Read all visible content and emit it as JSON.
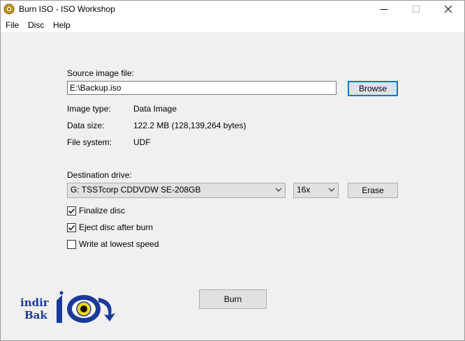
{
  "window": {
    "title": "Burn ISO - ISO Workshop"
  },
  "menu": [
    "File",
    "Disc",
    "Help"
  ],
  "source": {
    "label": "Source image file:",
    "value": "E:\\Backup.iso",
    "browse_label": "Browse"
  },
  "info": {
    "image_type_label": "Image type:",
    "image_type_value": "Data Image",
    "data_size_label": "Data size:",
    "data_size_value": "122.2 MB (128,139,264 bytes)",
    "file_system_label": "File system:",
    "file_system_value": "UDF"
  },
  "destination": {
    "label": "Destination drive:",
    "drive": "G: TSSTcorp CDDVDW SE-208GB",
    "speed": "16x",
    "erase_label": "Erase"
  },
  "options": [
    {
      "label": "Finalize disc",
      "checked": true
    },
    {
      "label": "Eject disc after burn",
      "checked": true
    },
    {
      "label": "Write at lowest speed",
      "checked": false
    }
  ],
  "burn_label": "Burn",
  "logo": {
    "line1": "indir",
    "line2": "Bak"
  },
  "colors": {
    "focus_accent": "#0078d7",
    "logo_blue": "#1a3a9a",
    "logo_eye_yellow": "#f5d800"
  }
}
